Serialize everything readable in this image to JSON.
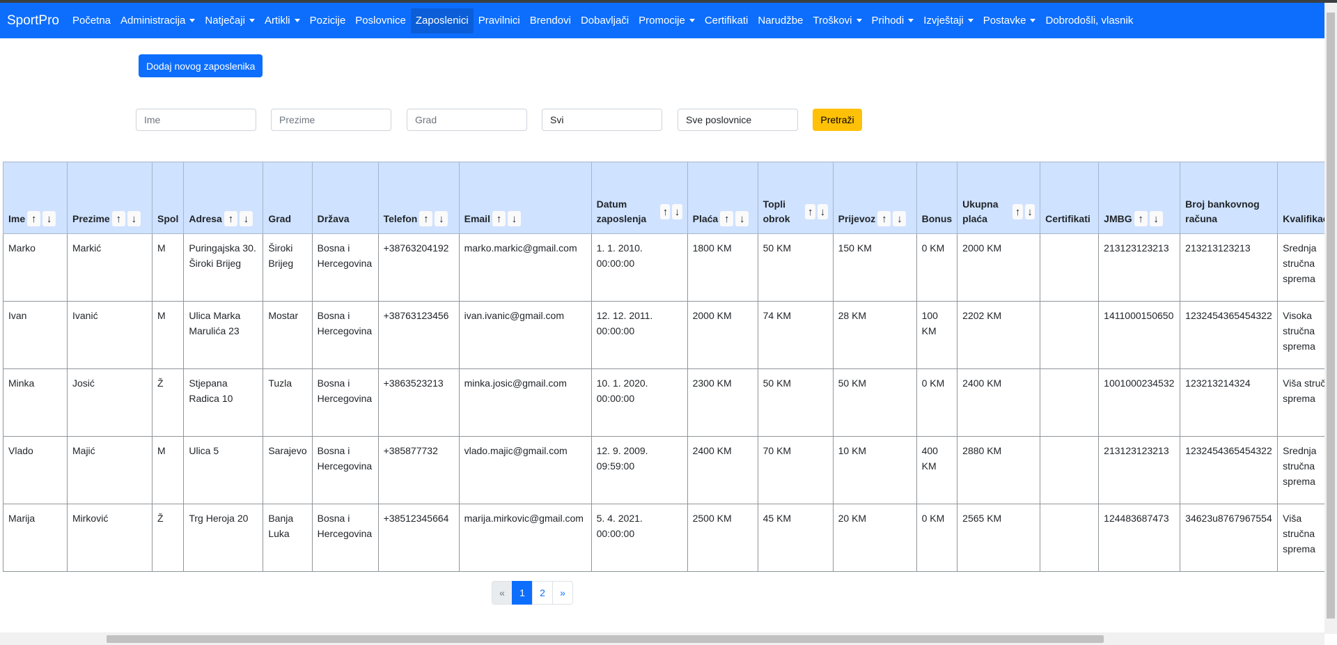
{
  "navbar": {
    "brand": "SportPro",
    "items": [
      {
        "label": "Početna",
        "dropdown": false,
        "active": false
      },
      {
        "label": "Administracija",
        "dropdown": true,
        "active": false
      },
      {
        "label": "Natječaji",
        "dropdown": true,
        "active": false
      },
      {
        "label": "Artikli",
        "dropdown": true,
        "active": false
      },
      {
        "label": "Pozicije",
        "dropdown": false,
        "active": false
      },
      {
        "label": "Poslovnice",
        "dropdown": false,
        "active": false
      },
      {
        "label": "Zaposlenici",
        "dropdown": false,
        "active": true
      },
      {
        "label": "Pravilnici",
        "dropdown": false,
        "active": false
      },
      {
        "label": "Brendovi",
        "dropdown": false,
        "active": false
      },
      {
        "label": "Dobavljači",
        "dropdown": false,
        "active": false
      },
      {
        "label": "Promocije",
        "dropdown": true,
        "active": false
      },
      {
        "label": "Certifikati",
        "dropdown": false,
        "active": false
      },
      {
        "label": "Narudžbe",
        "dropdown": false,
        "active": false
      },
      {
        "label": "Troškovi",
        "dropdown": true,
        "active": false
      },
      {
        "label": "Prihodi",
        "dropdown": true,
        "active": false
      },
      {
        "label": "Izvještaji",
        "dropdown": true,
        "active": false
      },
      {
        "label": "Postavke",
        "dropdown": true,
        "active": false
      },
      {
        "label": "Dobrodošli, vlasnik",
        "dropdown": false,
        "active": false
      }
    ]
  },
  "actions": {
    "add_employee": "Dodaj novog zaposlenika"
  },
  "filters": {
    "first_name_placeholder": "Ime",
    "last_name_placeholder": "Prezime",
    "city_placeholder": "Grad",
    "gender_value": "Svi",
    "branch_value": "Sve poslovnice",
    "search_label": "Pretraži"
  },
  "sort_icons": {
    "up": "↑",
    "down": "↓"
  },
  "table": {
    "columns": [
      {
        "label": "Ime",
        "sortable": true
      },
      {
        "label": "Prezime",
        "sortable": true
      },
      {
        "label": "Spol",
        "sortable": false
      },
      {
        "label": "Adresa",
        "sortable": true
      },
      {
        "label": "Grad",
        "sortable": false
      },
      {
        "label": "Država",
        "sortable": false
      },
      {
        "label": "Telefon",
        "sortable": true
      },
      {
        "label": "Email",
        "sortable": true
      },
      {
        "label": "Datum zaposlenja",
        "sortable": true
      },
      {
        "label": "Plaća",
        "sortable": true
      },
      {
        "label": "Topli obrok",
        "sortable": true
      },
      {
        "label": "Prijevoz",
        "sortable": true
      },
      {
        "label": "Bonus",
        "sortable": false
      },
      {
        "label": "Ukupna plaća",
        "sortable": true
      },
      {
        "label": "Certifikati",
        "sortable": false
      },
      {
        "label": "JMBG",
        "sortable": true
      },
      {
        "label": "Broj bankovnog računa",
        "sortable": false
      },
      {
        "label": "Kvalifikaci",
        "sortable": false
      }
    ],
    "rows": [
      [
        "Marko",
        "Markić",
        "M",
        "Puringajska 30. Široki Brijeg",
        "Široki Brijeg",
        "Bosna i Hercegovina",
        "+38763204192",
        "marko.markic@gmail.com",
        "1. 1. 2010. 00:00:00",
        "1800 KM",
        "50 KM",
        "150 KM",
        "0 KM",
        "2000 KM",
        "",
        "213123123213",
        "213213123213",
        "Srednja stručna sprema"
      ],
      [
        "Ivan",
        "Ivanić",
        "M",
        "Ulica Marka Marulića 23",
        "Mostar",
        "Bosna i Hercegovina",
        "+38763123456",
        "ivan.ivanic@gmail.com",
        "12. 12. 2011. 00:00:00",
        "2000 KM",
        "74 KM",
        "28 KM",
        "100 KM",
        "2202 KM",
        "",
        "1411000150650",
        "1232454365454322",
        "Visoka stručna sprema"
      ],
      [
        "Minka",
        "Josić",
        "Ž",
        "Stjepana Radica 10",
        "Tuzla",
        "Bosna i Hercegovina",
        "+3863523213",
        "minka.josic@gmail.com",
        "10. 1. 2020. 00:00:00",
        "2300 KM",
        "50 KM",
        "50 KM",
        "0 KM",
        "2400 KM",
        "",
        "1001000234532",
        "123213214324",
        "Viša stručn sprema"
      ],
      [
        "Vlado",
        "Majić",
        "M",
        "Ulica 5",
        "Sarajevo",
        "Bosna i Hercegovina",
        "+385877732",
        "vlado.majic@gmail.com",
        "12. 9. 2009. 09:59:00",
        "2400 KM",
        "70 KM",
        "10 KM",
        "400 KM",
        "2880 KM",
        "",
        "213123123213",
        "1232454365454322",
        "Srednja stručna sprema"
      ],
      [
        "Marija",
        "Mirković",
        "Ž",
        "Trg Heroja 20",
        "Banja Luka",
        "Bosna i Hercegovina",
        "+38512345664",
        "marija.mirkovic@gmail.com",
        "5. 4. 2021. 00:00:00",
        "2500 KM",
        "45 KM",
        "20 KM",
        "0 KM",
        "2565 KM",
        "",
        "124483687473",
        "34623u8767967554",
        "Viša stručna sprema"
      ]
    ]
  },
  "pagination": {
    "prev": "«",
    "pages": [
      "1",
      "2"
    ],
    "current": "1",
    "next": "»"
  }
}
